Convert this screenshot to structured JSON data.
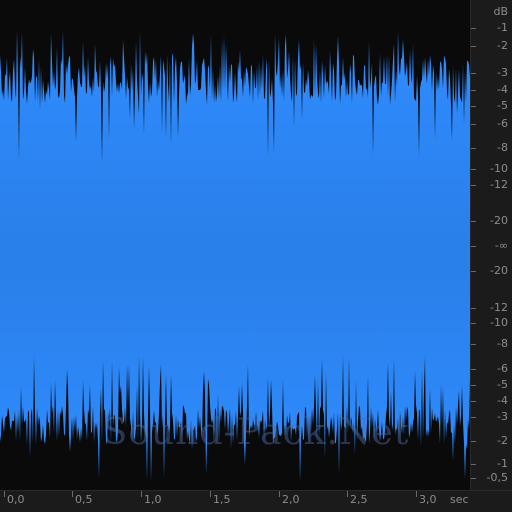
{
  "db_scale": {
    "unit_label": "dB",
    "top_labels": [
      "-1",
      "-2",
      "-3",
      "-4",
      "-5",
      "-6",
      "-8",
      "-10",
      "-12",
      "-20"
    ],
    "center_label": "-∞",
    "bottom_labels": [
      "-20",
      "-12",
      "-10",
      "-8",
      "-6",
      "-5",
      "-4",
      "-3",
      "-2",
      "-1",
      "-0,5"
    ]
  },
  "time_scale": {
    "labels": [
      "0,0",
      "0,5",
      "1,0",
      "1,5",
      "2,0",
      "2,5",
      "3,0"
    ],
    "unit_label": "sec"
  },
  "watermark": "Sound-Pack.Net",
  "colors": {
    "waveform": "#2e86f7",
    "background": "#0a0a0a",
    "ruler": "#1b1b1b",
    "ruler_text": "#8c8c8c"
  }
}
